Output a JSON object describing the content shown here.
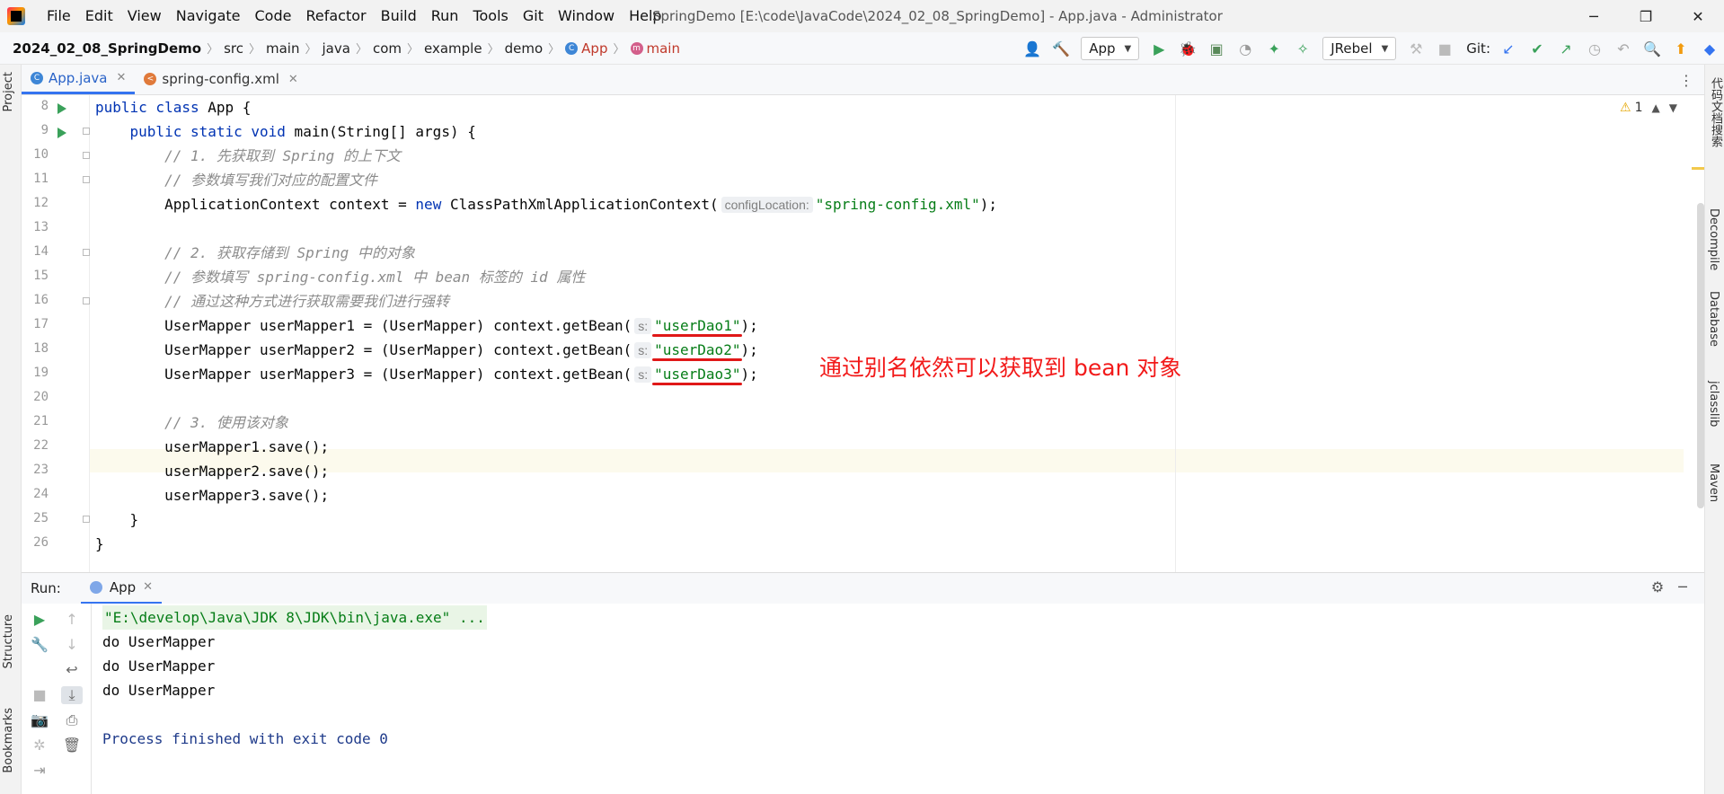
{
  "window": {
    "title": "SpringDemo [E:\\code\\JavaCode\\2024_02_08_SpringDemo] - App.java - Administrator",
    "minimize": "─",
    "maximize": "❐",
    "close": "✕"
  },
  "menu": [
    "File",
    "Edit",
    "View",
    "Navigate",
    "Code",
    "Refactor",
    "Build",
    "Run",
    "Tools",
    "Git",
    "Window",
    "Help"
  ],
  "breadcrumb": [
    "2024_02_08_SpringDemo",
    "src",
    "main",
    "java",
    "com",
    "example",
    "demo",
    "App",
    "main"
  ],
  "toolbar": {
    "run_config": "App",
    "jrebel": "JRebel",
    "git_label": "Git:"
  },
  "left_tools": [
    "Project",
    "Structure",
    "Bookmarks"
  ],
  "right_tools": [
    "代码文档搜索",
    "Decompile",
    "Database",
    "jclasslib",
    "Maven"
  ],
  "tabs": [
    {
      "label": "App.java",
      "active": true
    },
    {
      "label": "spring-config.xml",
      "active": false
    }
  ],
  "inspections": {
    "warnings": "1"
  },
  "editor": {
    "line_numbers": [
      "8",
      "9",
      "10",
      "11",
      "12",
      "13",
      "14",
      "15",
      "16",
      "17",
      "18",
      "19",
      "20",
      "21",
      "22",
      "23",
      "24",
      "25",
      "26"
    ],
    "l8": {
      "a": "public class",
      "b": " App {"
    },
    "l9": {
      "a": "    public static void",
      "b": " main(String[] args) {"
    },
    "l10": "        // 1. 先获取到 Spring 的上下文",
    "l11": "        // 参数填写我们对应的配置文件",
    "l12": {
      "a": "        ApplicationContext context = ",
      "kw": "new",
      "b": " ClassPathXmlApplicationContext(",
      "hint": "configLocation:",
      "str": "\"spring-config.xml\"",
      "c": ");"
    },
    "l14": "        // 2. 获取存储到 Spring 中的对象",
    "l15": "        // 参数填写 spring-config.xml 中 bean 标签的 id 属性",
    "l16": "        // 通过这种方式进行获取需要我们进行强转",
    "l17": {
      "a": "        UserMapper userMapper1 = (UserMapper) context.getBean(",
      "hint": "s:",
      "str": "\"userDao1\"",
      "c": ");"
    },
    "l18": {
      "a": "        UserMapper userMapper2 = (UserMapper) context.getBean(",
      "hint": "s:",
      "str": "\"userDao2\"",
      "c": ");"
    },
    "l19": {
      "a": "        UserMapper userMapper3 = (UserMapper) context.getBean(",
      "hint": "s:",
      "str": "\"userDao3\"",
      "c": ");"
    },
    "l21": "        // 3. 使用该对象",
    "l22": "        userMapper1.save();",
    "l23": "        userMapper2.save();",
    "l24": "        userMapper3.save();",
    "l25": "    }",
    "l26": "}"
  },
  "annotation": "通过别名依然可以获取到 bean 对象",
  "run_panel": {
    "label": "Run:",
    "tab": "App",
    "output": [
      "\"E:\\develop\\Java\\JDK 8\\JDK\\bin\\java.exe\" ...",
      "do UserMapper",
      "do UserMapper",
      "do UserMapper",
      "",
      "Process finished with exit code 0"
    ]
  }
}
